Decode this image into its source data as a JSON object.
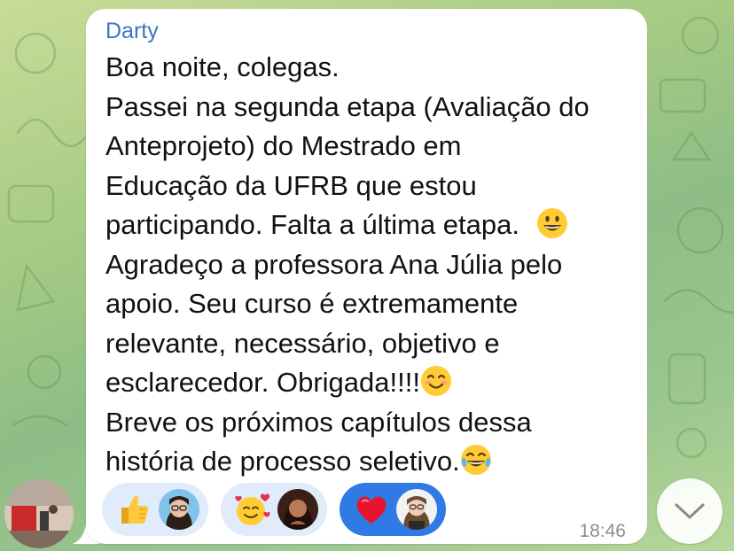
{
  "message": {
    "sender": "Darty",
    "lines": [
      "Boa noite, colegas.",
      "Passei na segunda etapa (Avaliação do",
      "Anteprojeto) do Mestrado em",
      "Educação da UFRB que estou",
      "participando. Falta a última etapa.",
      "Agradeço a professora Ana Júlia pelo",
      "apoio. Seu curso é extremamente",
      "relevante, necessário, objetivo e",
      "esclarecedor. Obrigada!!!!",
      "Breve os próximos capítulos dessa",
      "história de processo seletivo."
    ],
    "time": "18:46"
  },
  "reactions": [
    {
      "icon": "thumbs-up-emoji",
      "selected": false
    },
    {
      "icon": "smiling-face-with-hearts-emoji",
      "selected": false
    },
    {
      "icon": "red-heart-emoji",
      "selected": true
    }
  ],
  "colors": {
    "sender": "#3a76c4",
    "reaction_bg": "#e0ecfb",
    "reaction_selected_bg": "#2f7ae5",
    "time": "#8e8e93"
  }
}
